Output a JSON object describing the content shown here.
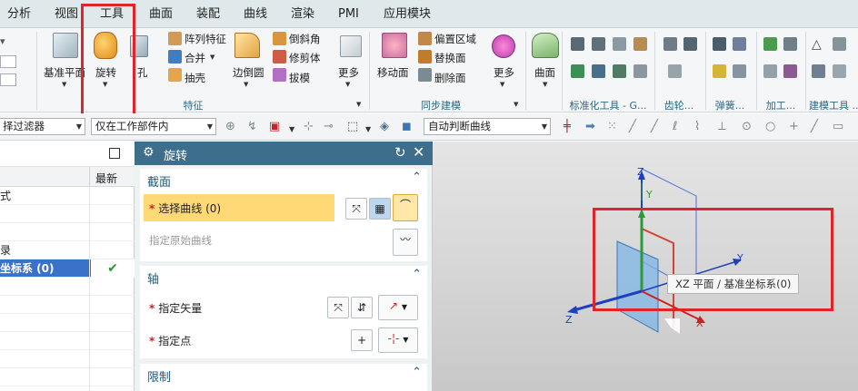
{
  "menubar": {
    "items": [
      "分析",
      "视图",
      "工具",
      "曲面",
      "装配",
      "曲线",
      "渲染",
      "PMI",
      "应用模块"
    ]
  },
  "ribbon": {
    "datum_plane": "基准平面",
    "revolve": "旋转",
    "hole": "孔",
    "pattern_feature": "阵列特征",
    "unite": "合并",
    "shell": "抽壳",
    "edge_blend": "边倒圆",
    "chamfer": "倒斜角",
    "trim_body": "修剪体",
    "draft": "拔模",
    "more": "更多",
    "feature_group": "特征",
    "move_face": "移动面",
    "offset_region": "偏置区域",
    "replace_face": "替换面",
    "delete_face": "删除面",
    "sync_group": "同步建模",
    "more2": "更多",
    "surface": "曲面",
    "std_tools": "标准化工具 - G...",
    "gear": "齿轮...",
    "spring": "弹簧...",
    "machining": "加工...",
    "build_tools": "建模工具 ..."
  },
  "toolbar2": {
    "filter": "择过滤器",
    "scope": "仅在工作部件内",
    "curve_rule": "自动判断曲线"
  },
  "navigator": {
    "header_latest": "最新",
    "rows": [
      "式",
      "",
      "",
      "录",
      "坐标系 (0)"
    ],
    "check": "✔"
  },
  "dialog": {
    "title": "旋转",
    "section": "截面",
    "select_curve": "选择曲线 (0)",
    "origin_curve": "指定原始曲线",
    "axis": "轴",
    "vector": "指定矢量",
    "point": "指定点",
    "limit": "限制"
  },
  "viewport": {
    "tooltip": "XZ 平面 / 基准坐标系(0)",
    "axis_z": "Z",
    "axis_y": "Y",
    "axis_x": "X"
  },
  "colors": {
    "dialog_title": "#3d6f8d",
    "highlight": "#ffd976",
    "red_box": "#e0242a",
    "plane": "#7fb6e6"
  }
}
